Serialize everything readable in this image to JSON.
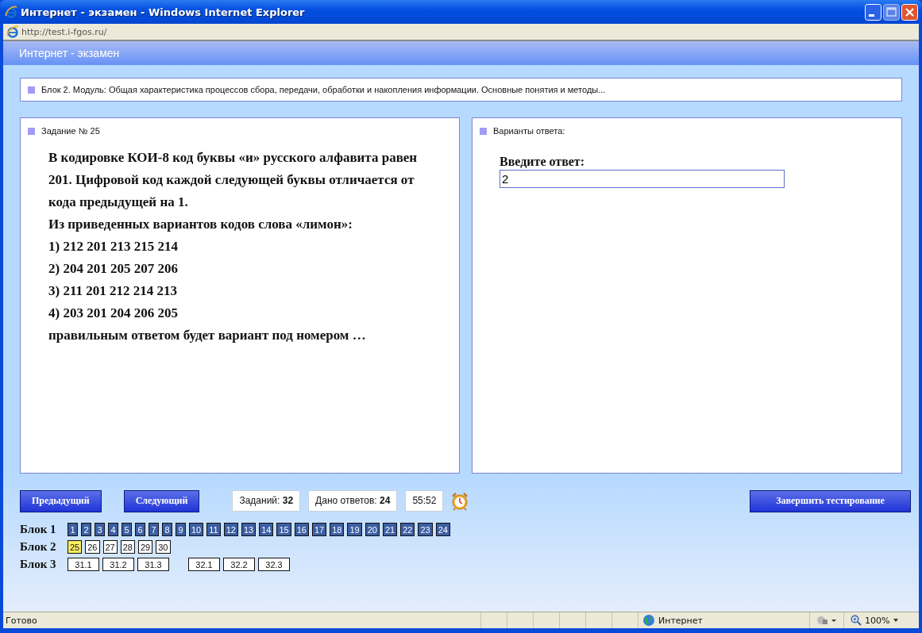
{
  "window": {
    "title": "Интернет - экзамен - Windows Internet Explorer"
  },
  "address_bar": {
    "url": "http://test.i-fgos.ru/"
  },
  "page_header": {
    "title": "Интернет - экзамен"
  },
  "block_caption": "Блок 2. Модуль: Общая характеристика процессов сбора, передачи, обработки и накопления информации. Основные понятия и методы...",
  "task_panel": {
    "heading": "Задание № 25",
    "paragraphs": [
      "В кодировке КОИ-8 код буквы «и» русского алфавита равен 201. Цифровой код каждой следующей буквы отличается от кода предыдущей на 1.",
      "Из приведенных вариантов кодов слова «лимон»:",
      "1) 212 201 213 215 214",
      "2) 204 201 205 207 206",
      "3) 211 201 212 214 213",
      "4) 203 201 204 206 205",
      "правильным ответом будет вариант под номером …"
    ]
  },
  "answer_panel": {
    "heading": "Варианты ответа:",
    "prompt": "Введите ответ:",
    "value": "2"
  },
  "toolbar": {
    "prev_button": "Предыдущий",
    "next_button": "Следующий",
    "counters": [
      "Заданий: **32**",
      "Дано ответов: **24**"
    ],
    "timer": "55:52",
    "finish_button": "Завершить тестирование"
  },
  "blocks": [
    {
      "label": "Блок 1",
      "groups": [
        [
          {
            "label": "1",
            "answered": true,
            "selected": false
          },
          {
            "label": "2",
            "answered": true,
            "selected": false
          },
          {
            "label": "3",
            "answered": true,
            "selected": false
          },
          {
            "label": "4",
            "answered": true,
            "selected": false
          },
          {
            "label": "5",
            "answered": true,
            "selected": false
          },
          {
            "label": "6",
            "answered": true,
            "selected": false
          },
          {
            "label": "7",
            "answered": true,
            "selected": false
          },
          {
            "label": "8",
            "answered": true,
            "selected": false
          },
          {
            "label": "9",
            "answered": true,
            "selected": false
          },
          {
            "label": "10",
            "answered": true,
            "selected": false
          },
          {
            "label": "11",
            "answered": true,
            "selected": false
          },
          {
            "label": "12",
            "answered": true,
            "selected": false
          },
          {
            "label": "13",
            "answered": true,
            "selected": false
          },
          {
            "label": "14",
            "answered": true,
            "selected": false
          },
          {
            "label": "15",
            "answered": true,
            "selected": false
          },
          {
            "label": "16",
            "answered": true,
            "selected": false
          },
          {
            "label": "17",
            "answered": true,
            "selected": false
          },
          {
            "label": "18",
            "answered": true,
            "selected": false
          },
          {
            "label": "19",
            "answered": true,
            "selected": false
          },
          {
            "label": "20",
            "answered": true,
            "selected": false
          },
          {
            "label": "21",
            "answered": true,
            "selected": false
          },
          {
            "label": "22",
            "answered": true,
            "selected": false
          },
          {
            "label": "23",
            "answered": true,
            "selected": false
          },
          {
            "label": "24",
            "answered": true,
            "selected": false
          }
        ]
      ]
    },
    {
      "label": "Блок 2",
      "groups": [
        [
          {
            "label": "25",
            "answered": false,
            "selected": true
          },
          {
            "label": "26",
            "answered": false,
            "selected": false
          },
          {
            "label": "27",
            "answered": false,
            "selected": false
          },
          {
            "label": "28",
            "answered": false,
            "selected": false
          },
          {
            "label": "29",
            "answered": false,
            "selected": false
          },
          {
            "label": "30",
            "answered": false,
            "selected": false
          }
        ]
      ]
    },
    {
      "label": "Блок 3",
      "groups": [
        [
          {
            "label": "31.1",
            "answered": false,
            "selected": false
          },
          {
            "label": "31.2",
            "answered": false,
            "selected": false
          },
          {
            "label": "31.3",
            "answered": false,
            "selected": false
          }
        ],
        [
          {
            "label": "32.1",
            "answered": false,
            "selected": false
          },
          {
            "label": "32.2",
            "answered": false,
            "selected": false
          },
          {
            "label": "32.3",
            "answered": false,
            "selected": false
          }
        ]
      ]
    }
  ],
  "status_bar": {
    "text": "Готово",
    "zone": "Интернет",
    "zoom": "100%"
  }
}
